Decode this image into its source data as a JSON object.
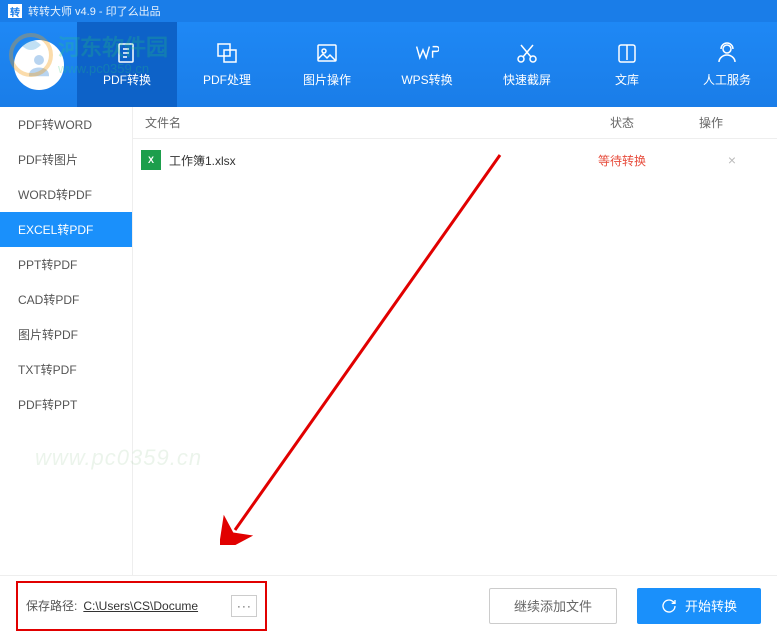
{
  "titlebar": {
    "app_icon": "转",
    "title": "转转大师 v4.9 - 印了么出品"
  },
  "nav_tabs": [
    {
      "label": "PDF转换",
      "icon": "pdf",
      "active": true
    },
    {
      "label": "PDF处理",
      "icon": "layers",
      "active": false
    },
    {
      "label": "图片操作",
      "icon": "image",
      "active": false
    },
    {
      "label": "WPS转换",
      "icon": "wps",
      "active": false
    },
    {
      "label": "快速截屏",
      "icon": "scissors",
      "active": false
    },
    {
      "label": "文库",
      "icon": "library",
      "active": false
    },
    {
      "label": "人工服务",
      "icon": "support",
      "active": false
    }
  ],
  "sidebar": {
    "items": [
      {
        "label": "PDF转WORD",
        "active": false
      },
      {
        "label": "PDF转图片",
        "active": false
      },
      {
        "label": "WORD转PDF",
        "active": false
      },
      {
        "label": "EXCEL转PDF",
        "active": true
      },
      {
        "label": "PPT转PDF",
        "active": false
      },
      {
        "label": "CAD转PDF",
        "active": false
      },
      {
        "label": "图片转PDF",
        "active": false
      },
      {
        "label": "TXT转PDF",
        "active": false
      },
      {
        "label": "PDF转PPT",
        "active": false
      }
    ]
  },
  "list": {
    "headers": {
      "name": "文件名",
      "status": "状态",
      "action": "操作"
    },
    "rows": [
      {
        "icon": "X",
        "name": "工作簿1.xlsx",
        "status": "等待转换"
      }
    ]
  },
  "footer": {
    "path_label": "保存路径:",
    "path_value": "C:\\Users\\CS\\Docume",
    "browse_label": "···",
    "add_button": "继续添加文件",
    "start_button": "开始转换"
  },
  "watermark": {
    "text1": "河东软件园",
    "url": "www.pc0359.cn",
    "text2": "www.pc0359.cn"
  }
}
